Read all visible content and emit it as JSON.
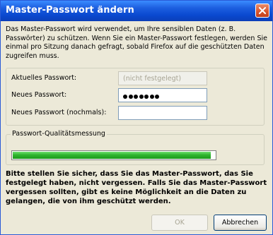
{
  "window": {
    "title": "Master-Passwort ändern"
  },
  "intro": "Das Master-Passwort wird verwendet, um Ihre sensiblen Daten (z. B. Passwörter) zu schützen. Wenn Sie ein Master-Passwort festlegen, werden Sie einmal pro Sitzung danach gefragt, sobald Firefox auf die geschützten Daten zugreifen muss.",
  "fields": {
    "current_label": "Aktuelles Passwort:",
    "current_value": "(nicht festgelegt)",
    "new_label": "Neues Passwort:",
    "new_masked_length": 7,
    "confirm_label": "Neues Passwort (nochmals):",
    "confirm_value": ""
  },
  "quality": {
    "label": "Passwort-Qualitätsmessung",
    "fraction": 0.98
  },
  "warning": "Bitte stellen Sie sicher, dass Sie das Master-Passwort, das Sie festgelegt haben, nicht vergessen. Falls Sie das Master-Passwort vergessen sollten, gibt es keine Möglichkeit an die Daten zu gelangen, die von ihm geschützt werden.",
  "buttons": {
    "ok": "OK",
    "cancel": "Abbrechen"
  },
  "colors": {
    "titlebar": "#0a49d0",
    "dialog_bg": "#ECE9D8",
    "meter_fill": "#2fb52f"
  }
}
